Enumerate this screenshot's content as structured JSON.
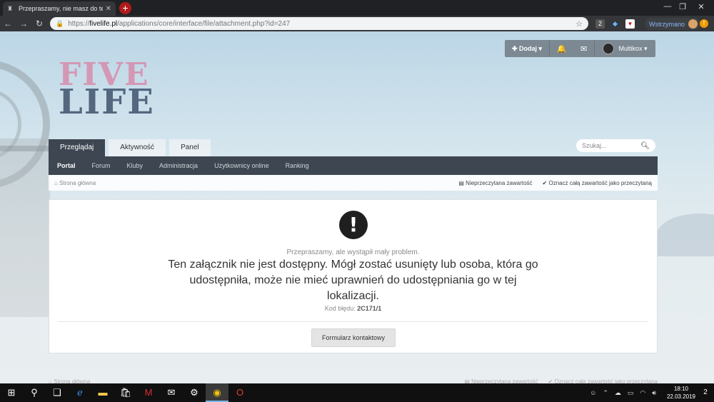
{
  "browser": {
    "tab_title": "Przepraszamy, nie masz do tego...",
    "url_prefix": "https://",
    "url_host": "fivelife.pl",
    "url_path": "/applications/core/interface/file/attachment.php?id=247",
    "paused_label": "Wstrzymano",
    "ext_badge": "2"
  },
  "site": {
    "logo_top": "FIVE",
    "logo_bottom": "LIFE",
    "userbar": {
      "add_label": "Dodaj",
      "username": "Multikox"
    },
    "tabs": [
      "Przeglądaj",
      "Aktywność",
      "Panel"
    ],
    "search_placeholder": "Szukaj...",
    "subnav": [
      "Portal",
      "Forum",
      "Kluby",
      "Administracja",
      "Użytkownicy online",
      "Ranking"
    ],
    "breadcrumb_home": "Strona główna",
    "unread_label": "Nieprzeczytana zawartość",
    "mark_read_label": "Oznacz całą zawartość jako przeczytaną"
  },
  "error": {
    "sorry": "Przepraszamy, ale wystąpił mały problem.",
    "message": "Ten załącznik nie jest dostępny. Mógł zostać usunięty lub osoba, która go udostępniła, może nie mieć uprawnień do udostępniania go w tej lokalizacji.",
    "code_label": "Kod błędu:",
    "code_value": "2C171/1",
    "contact_button": "Formularz kontaktowy"
  },
  "taskbar": {
    "time": "18:10",
    "date": "22.03.2019",
    "notifications": "2"
  },
  "colors": {
    "nav_dark": "#3d4651",
    "userbar": "#7c8892",
    "newtab_red": "#b11a1a"
  }
}
